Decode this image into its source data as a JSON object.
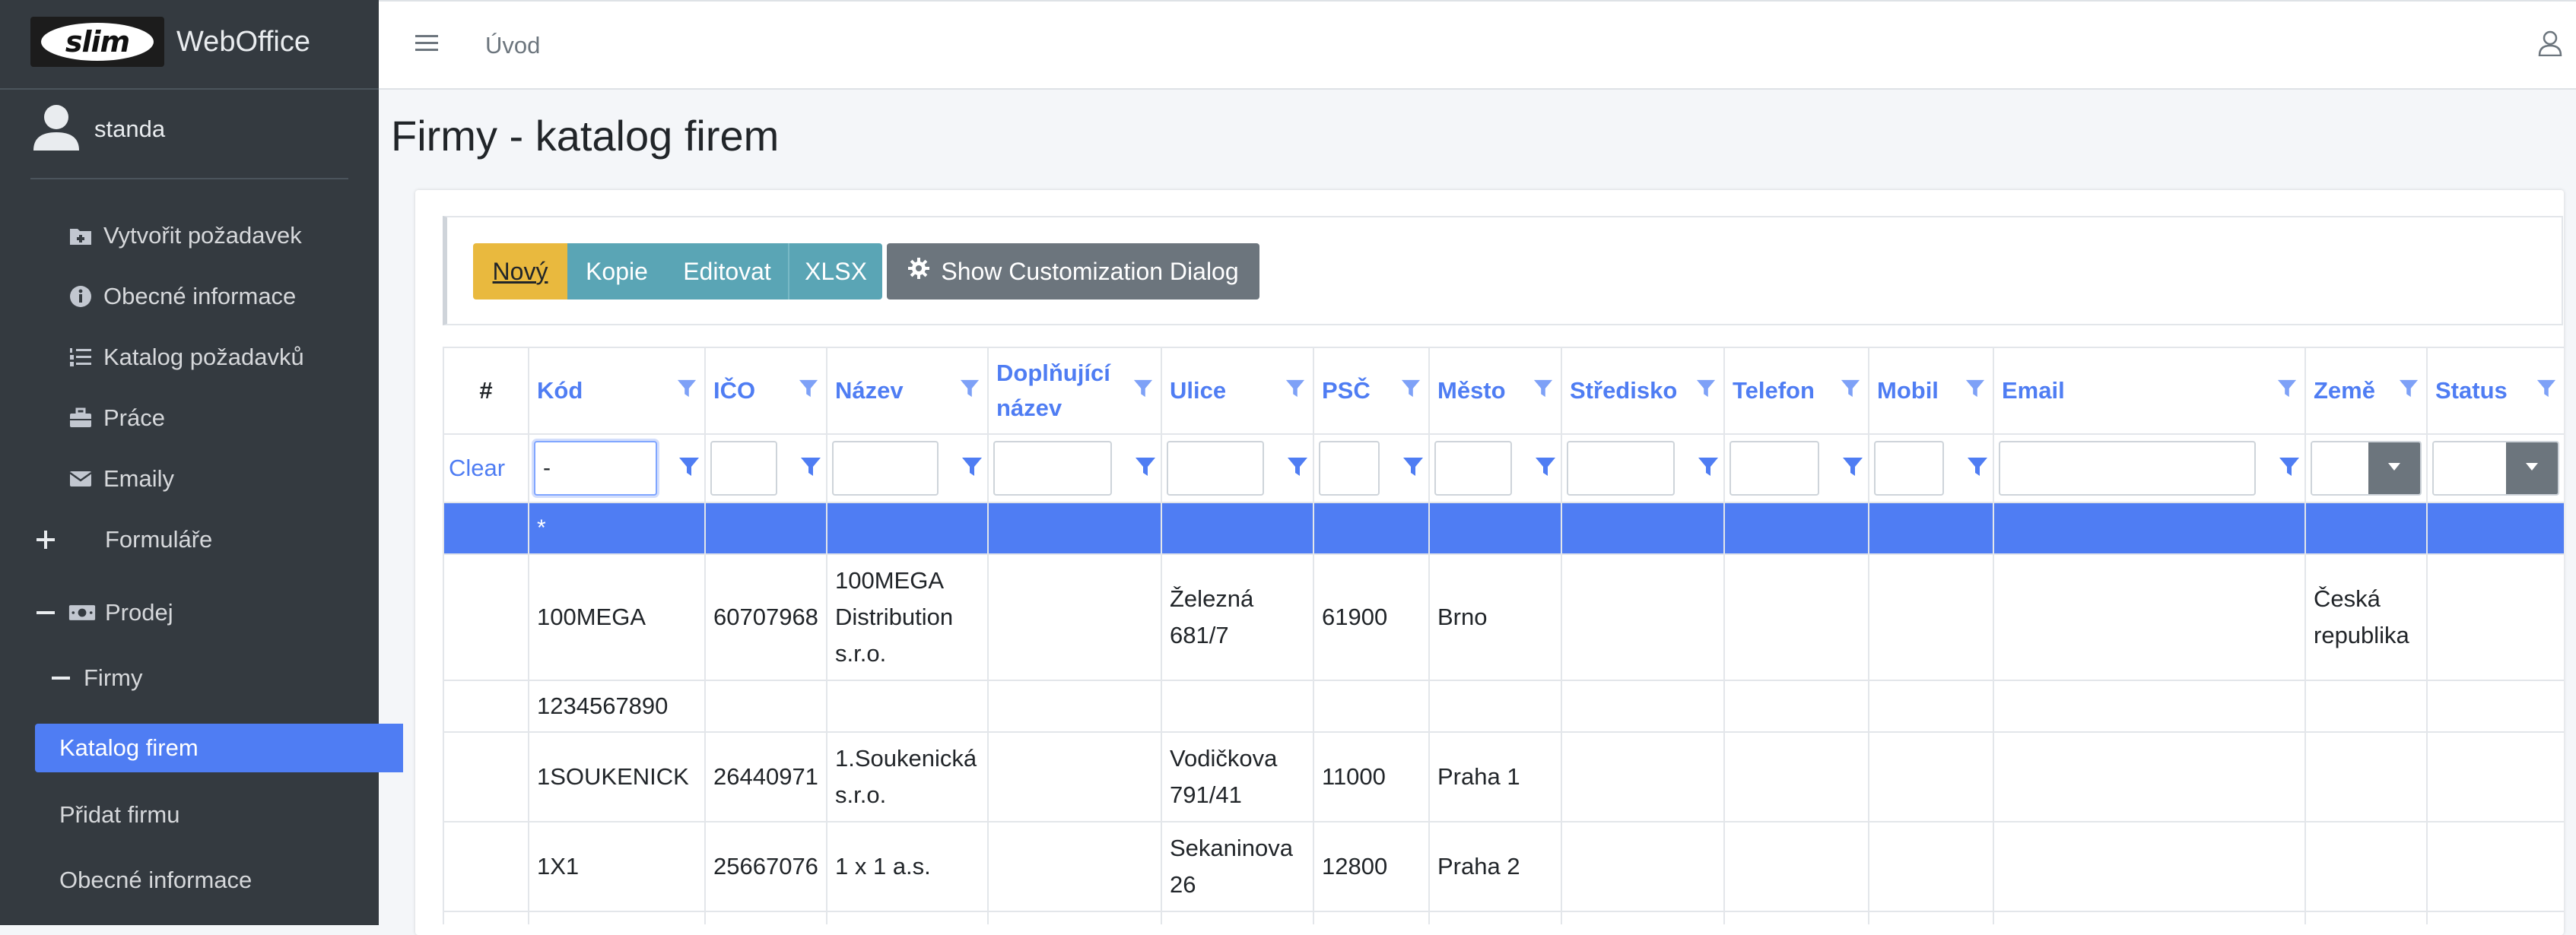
{
  "brand": {
    "logo_text": "slim",
    "app_name": "WebOffice"
  },
  "user": {
    "name": "standa"
  },
  "sidebar": {
    "items": [
      {
        "label": "Vytvořit požadavek",
        "icon": "folder-plus-icon"
      },
      {
        "label": "Obecné informace",
        "icon": "info-circle-icon"
      },
      {
        "label": "Katalog požadavků",
        "icon": "list-ol-icon"
      },
      {
        "label": "Práce",
        "icon": "briefcase-icon"
      },
      {
        "label": "Emaily",
        "icon": "envelope-icon"
      },
      {
        "label": "Formuláře",
        "icon": "plus-icon"
      },
      {
        "label": "Prodej",
        "icon": "money-bill-icon"
      },
      {
        "label": "Firmy",
        "icon": "minus-icon"
      },
      {
        "label": "Katalog firem",
        "icon": "",
        "active": true
      },
      {
        "label": "Přidat firmu",
        "icon": ""
      },
      {
        "label": "Obecné informace",
        "icon": ""
      }
    ]
  },
  "topbar": {
    "breadcrumb": "Úvod"
  },
  "page": {
    "title": "Firmy - katalog firem"
  },
  "toolbar": {
    "new_label": "Nový",
    "copy_label": "Kopie",
    "edit_label": "Editovat",
    "xlsx_label": "XLSX",
    "customize_label": "Show Customization Dialog"
  },
  "grid": {
    "columns": [
      {
        "label": "#"
      },
      {
        "label": "Kód"
      },
      {
        "label": "IČO"
      },
      {
        "label": "Název"
      },
      {
        "label": "Doplňující název"
      },
      {
        "label": "Ulice"
      },
      {
        "label": "PSČ"
      },
      {
        "label": "Město"
      },
      {
        "label": "Středisko"
      },
      {
        "label": "Telefon"
      },
      {
        "label": "Mobil"
      },
      {
        "label": "Email"
      },
      {
        "label": "Země"
      },
      {
        "label": "Status"
      }
    ],
    "clear_label": "Clear",
    "kod_filter_value": "-",
    "new_row_marker": "*",
    "rows": [
      {
        "kod": "100MEGA",
        "ico": "60707968",
        "nazev": "100MEGA Distribution s.r.o.",
        "dopl": "",
        "ulice": "Železná 681/7",
        "psc": "61900",
        "mesto": "Brno",
        "stredisko": "",
        "telefon": "",
        "mobil": "",
        "email": "",
        "zeme": "Česká republika",
        "status": ""
      },
      {
        "kod": "1234567890",
        "ico": "",
        "nazev": "",
        "dopl": "",
        "ulice": "",
        "psc": "",
        "mesto": "",
        "stredisko": "",
        "telefon": "",
        "mobil": "",
        "email": "",
        "zeme": "",
        "status": ""
      },
      {
        "kod": "1SOUKENICK",
        "ico": "26440971",
        "nazev": "1.Soukenická s.r.o.",
        "dopl": "",
        "ulice": "Vodičkova 791/41",
        "psc": "11000",
        "mesto": "Praha 1",
        "stredisko": "",
        "telefon": "",
        "mobil": "",
        "email": "",
        "zeme": "",
        "status": ""
      },
      {
        "kod": "1X1",
        "ico": "25667076",
        "nazev": "1 x 1 a.s.",
        "dopl": "",
        "ulice": "Sekaninova 26",
        "psc": "12800",
        "mesto": "Praha 2",
        "stredisko": "",
        "telefon": "",
        "mobil": "",
        "email": "",
        "zeme": "",
        "status": ""
      }
    ]
  },
  "colors": {
    "primary": "#4f7df3",
    "sidebar_bg": "#343a40",
    "warning": "#e9b93e",
    "info": "#5aa5b5",
    "secondary": "#6c757d"
  }
}
